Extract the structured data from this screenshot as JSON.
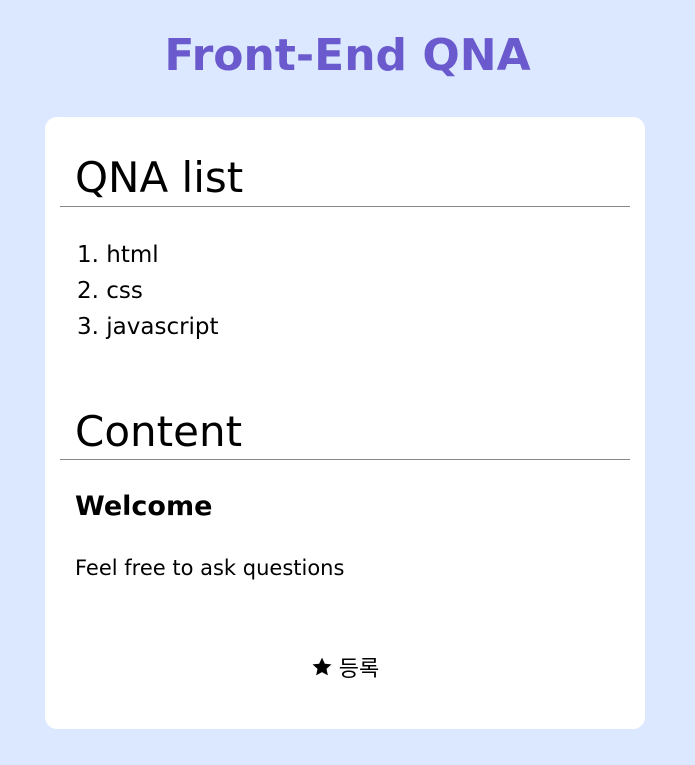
{
  "header": {
    "title": "Front-End QNA"
  },
  "qna_list": {
    "heading": "QNA list",
    "items": [
      {
        "marker": "1.",
        "label": "html"
      },
      {
        "marker": "2.",
        "label": "css"
      },
      {
        "marker": "3.",
        "label": "javascript"
      }
    ]
  },
  "content": {
    "heading": "Content",
    "title": "Welcome",
    "text": "Feel free to ask questions"
  },
  "register_button": {
    "icon": "star-icon",
    "label": "등록"
  },
  "colors": {
    "background": "#dbe8ff",
    "title": "#6a5acd",
    "card": "#ffffff",
    "divider": "#888888"
  }
}
